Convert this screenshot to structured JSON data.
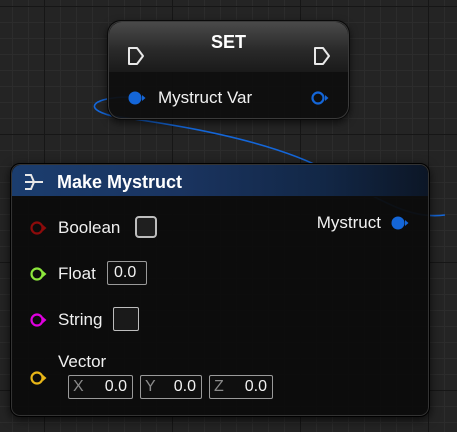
{
  "set_node": {
    "title": "SET",
    "input_pin_label": "Mystruct Var",
    "colors": {
      "exec": "#e8e8e8",
      "struct_pin": "#1466d8"
    }
  },
  "make_node": {
    "title": "Make Mystruct",
    "output_label": "Mystruct",
    "pins": {
      "boolean": {
        "label": "Boolean",
        "color": "#8c0b0b",
        "checked": false
      },
      "float": {
        "label": "Float",
        "value": "0.0",
        "color": "#8ce63c"
      },
      "string": {
        "label": "String",
        "value": "",
        "color": "#e000e0"
      },
      "vector": {
        "label": "Vector",
        "color": "#e8b618",
        "x_label": "X",
        "x_value": "0.0",
        "y_label": "Y",
        "y_value": "0.0",
        "z_label": "Z",
        "z_value": "0.0"
      }
    },
    "header_colors": [
      "#1b3d6e",
      "#0c1626"
    ],
    "wire_color": "#1466d8"
  }
}
